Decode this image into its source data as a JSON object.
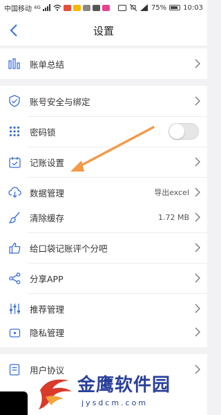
{
  "status_bar": {
    "carrier": "中国移动",
    "signal": "4G",
    "battery": "75%",
    "time": "10:03"
  },
  "header": {
    "title": "设置",
    "back_icon": "chevron-left-icon"
  },
  "colors": {
    "accent": "#3a6fd8",
    "annotation_arrow": "#f39a4a",
    "watermark": "#2a3f9a"
  },
  "settings": {
    "bill_summary": {
      "label": "账单总结",
      "icon": "bar-chart-icon"
    },
    "account_security": {
      "label": "账号安全与绑定",
      "icon": "shield-check-icon"
    },
    "password_lock": {
      "label": "密码锁",
      "icon": "keypad-icon",
      "toggle_on": false
    },
    "bookkeeping_settings": {
      "label": "记账设置",
      "icon": "calendar-check-icon"
    },
    "data_management": {
      "label": "数据管理",
      "icon": "cloud-download-icon",
      "value": "导出excel"
    },
    "clear_cache": {
      "label": "清除缓存",
      "icon": "brush-icon",
      "value": "1.72 MB"
    },
    "rate_app": {
      "label": "给口袋记账评个分吧",
      "icon": "thumbs-up-icon"
    },
    "share_app": {
      "label": "分享APP",
      "icon": "share-icon"
    },
    "recommended": {
      "label": "推荐管理",
      "icon": "sliders-icon"
    },
    "privacy": {
      "label": "隐私管理",
      "icon": "lock-icon"
    },
    "user_agreement": {
      "label": "用户协议",
      "icon": "document-icon"
    }
  },
  "watermark": {
    "name": "金鹰软件园",
    "url": "jysdcm.com"
  }
}
